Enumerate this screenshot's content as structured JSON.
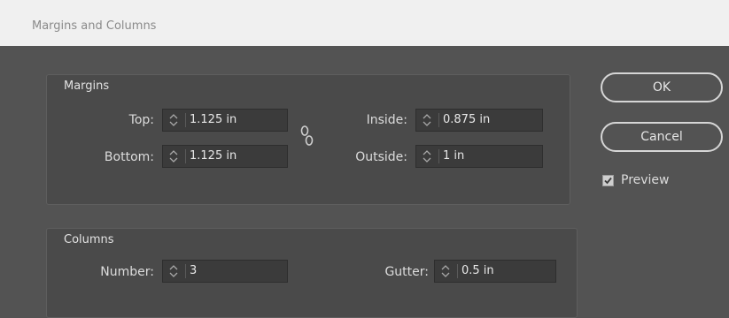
{
  "dialog": {
    "title": "Margins and Columns"
  },
  "margins": {
    "group_title": "Margins",
    "top": {
      "label": "Top:",
      "value": "1.125 in"
    },
    "bottom": {
      "label": "Bottom:",
      "value": "1.125 in"
    },
    "inside": {
      "label": "Inside:",
      "value": "0.875 in"
    },
    "outside": {
      "label": "Outside:",
      "value": "1 in"
    }
  },
  "columns": {
    "group_title": "Columns",
    "number": {
      "label": "Number:",
      "value": "3"
    },
    "gutter": {
      "label": "Gutter:",
      "value": "0.5 in"
    }
  },
  "buttons": {
    "ok": "OK",
    "cancel": "Cancel"
  },
  "preview": {
    "label": "Preview",
    "checked": true
  },
  "icons": {
    "spinner": "spinner-arrows-icon",
    "link": "chain-link-icon",
    "check": "checkmark-icon"
  }
}
